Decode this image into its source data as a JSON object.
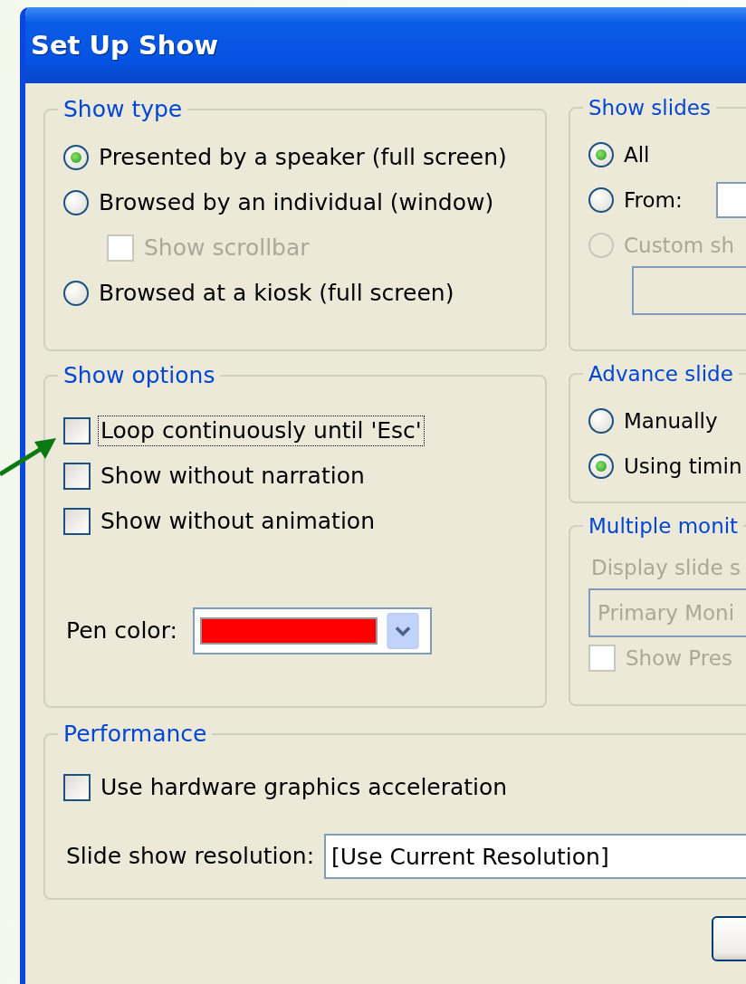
{
  "window": {
    "title": "Set Up Show"
  },
  "show_type": {
    "title": "Show type",
    "items": [
      {
        "kind": "radio",
        "label": "Presented by a speaker (full screen)",
        "selected": true,
        "disabled": false
      },
      {
        "kind": "radio",
        "label": "Browsed by an individual (window)",
        "selected": false,
        "disabled": false,
        "children": [
          {
            "kind": "checkbox",
            "label": "Show scrollbar",
            "checked": false,
            "disabled": true
          }
        ]
      },
      {
        "kind": "radio",
        "label": "Browsed at a kiosk (full screen)",
        "selected": false,
        "disabled": false
      }
    ]
  },
  "show_options": {
    "title": "Show options",
    "items": [
      {
        "kind": "checkbox",
        "label": "Loop continuously until 'Esc'",
        "checked": false,
        "disabled": false,
        "focused": true
      },
      {
        "kind": "checkbox",
        "label": "Show without narration",
        "checked": false,
        "disabled": false,
        "focused": false
      },
      {
        "kind": "checkbox",
        "label": "Show without animation",
        "checked": false,
        "disabled": false,
        "focused": false
      }
    ],
    "pen_color": {
      "label": "Pen color:",
      "color": "#ff0000"
    }
  },
  "show_slides": {
    "title": "Show slides",
    "items": [
      {
        "kind": "radio",
        "label": "All",
        "selected": true,
        "disabled": false
      },
      {
        "kind": "radio_field",
        "label": "From:",
        "selected": false,
        "disabled": false
      },
      {
        "kind": "radio",
        "label": "Custom sh",
        "selected": false,
        "disabled": true
      },
      {
        "kind": "select",
        "disabled": true
      }
    ]
  },
  "advance_slides": {
    "title": "Advance slide",
    "items": [
      {
        "kind": "radio",
        "label": "Manually",
        "selected": false,
        "disabled": false
      },
      {
        "kind": "radio",
        "label": "Using timin",
        "selected": true,
        "disabled": false
      }
    ]
  },
  "multiple_monitors": {
    "title": "Multiple monit",
    "items": [
      {
        "kind": "label",
        "label": "Display slide s",
        "disabled": true
      },
      {
        "kind": "select",
        "value": "Primary Moni",
        "disabled": true
      },
      {
        "kind": "checkbox",
        "label": "Show Pres",
        "checked": false,
        "disabled": true
      }
    ]
  },
  "performance": {
    "title": "Performance",
    "items": [
      {
        "kind": "checkbox",
        "label": "Use hardware graphics acceleration",
        "checked": false,
        "disabled": false
      }
    ],
    "resolution": {
      "label": "Slide show resolution:",
      "value": "[Use Current Resolution]"
    }
  }
}
